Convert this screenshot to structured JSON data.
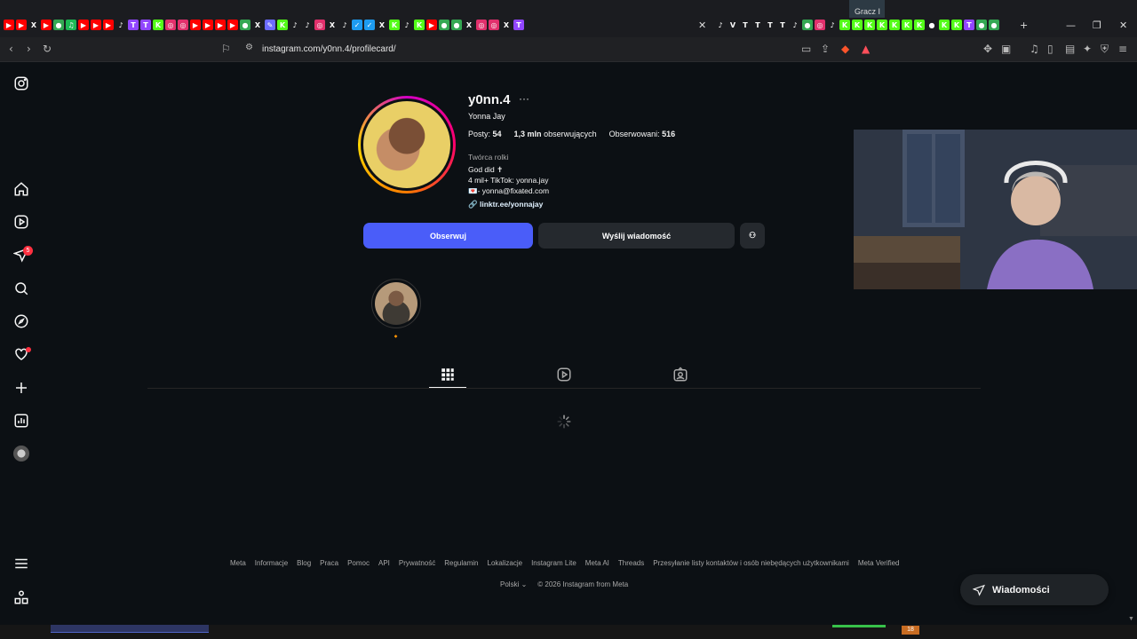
{
  "browser": {
    "url": "instagram.com/y0nn.4/profilecard/",
    "overlay_label": "Gracz I",
    "new_tab_symbol": "+",
    "tab_favicons": [
      {
        "name": "youtube-favicon",
        "color": "#ff0000",
        "glyph": "▶"
      },
      {
        "name": "youtube-favicon",
        "color": "#ff0000",
        "glyph": "▶"
      },
      {
        "name": "x-favicon",
        "color": "#1b1c20",
        "glyph": "X"
      },
      {
        "name": "youtube-favicon",
        "color": "#ff0000",
        "glyph": "▶"
      },
      {
        "name": "chrome-favicon",
        "color": "#34a853",
        "glyph": "●"
      },
      {
        "name": "green-favicon",
        "color": "#1db954",
        "glyph": "♫"
      },
      {
        "name": "youtube-favicon",
        "color": "#ff0000",
        "glyph": "▶"
      },
      {
        "name": "youtube-favicon",
        "color": "#ff0000",
        "glyph": "▶"
      },
      {
        "name": "youtube-favicon",
        "color": "#ff0000",
        "glyph": "▶"
      },
      {
        "name": "tiktok-favicon",
        "color": "#1b1c20",
        "glyph": "♪"
      },
      {
        "name": "twitch-favicon",
        "color": "#9146ff",
        "glyph": "T"
      },
      {
        "name": "twitch-favicon",
        "color": "#9146ff",
        "glyph": "T"
      },
      {
        "name": "kick-favicon",
        "color": "#53fc18",
        "glyph": "K"
      },
      {
        "name": "instagram-favicon",
        "color": "#e1306c",
        "glyph": "◎"
      },
      {
        "name": "instagram-favicon",
        "color": "#e1306c",
        "glyph": "◎"
      },
      {
        "name": "youtube-favicon",
        "color": "#ff0000",
        "glyph": "▶"
      },
      {
        "name": "youtube-favicon",
        "color": "#ff0000",
        "glyph": "▶"
      },
      {
        "name": "youtube-favicon",
        "color": "#ff0000",
        "glyph": "▶"
      },
      {
        "name": "youtube-favicon",
        "color": "#ff0000",
        "glyph": "▶"
      },
      {
        "name": "chrome-favicon",
        "color": "#34a853",
        "glyph": "●"
      },
      {
        "name": "x-favicon",
        "color": "#1b1c20",
        "glyph": "X"
      },
      {
        "name": "edit-favicon",
        "color": "#6c6cff",
        "glyph": "✎"
      },
      {
        "name": "kick-favicon",
        "color": "#53fc18",
        "glyph": "K"
      },
      {
        "name": "tiktok-favicon",
        "color": "#1b1c20",
        "glyph": "♪"
      },
      {
        "name": "tiktok-favicon",
        "color": "#1b1c20",
        "glyph": "♪"
      },
      {
        "name": "instagram-favicon",
        "color": "#e1306c",
        "glyph": "◎"
      },
      {
        "name": "x-favicon",
        "color": "#1b1c20",
        "glyph": "X"
      },
      {
        "name": "tiktok-favicon",
        "color": "#1b1c20",
        "glyph": "♪"
      },
      {
        "name": "check-favicon",
        "color": "#1d9bf0",
        "glyph": "✓"
      },
      {
        "name": "check-favicon",
        "color": "#1d9bf0",
        "glyph": "✓"
      },
      {
        "name": "x-favicon",
        "color": "#1b1c20",
        "glyph": "X"
      },
      {
        "name": "kick-favicon",
        "color": "#53fc18",
        "glyph": "K"
      },
      {
        "name": "tiktok-favicon",
        "color": "#1b1c20",
        "glyph": "♪"
      },
      {
        "name": "kick-favicon",
        "color": "#53fc18",
        "glyph": "K"
      },
      {
        "name": "youtube-favicon",
        "color": "#ff0000",
        "glyph": "▶"
      },
      {
        "name": "chrome-favicon",
        "color": "#34a853",
        "glyph": "●"
      },
      {
        "name": "chrome-favicon",
        "color": "#34a853",
        "glyph": "●"
      },
      {
        "name": "x-favicon",
        "color": "#1b1c20",
        "glyph": "X"
      },
      {
        "name": "instagram-favicon",
        "color": "#e1306c",
        "glyph": "◎"
      },
      {
        "name": "instagram-favicon",
        "color": "#e1306c",
        "glyph": "◎"
      },
      {
        "name": "x-favicon",
        "color": "#1b1c20",
        "glyph": "X"
      },
      {
        "name": "twitch-favicon",
        "color": "#9146ff",
        "glyph": "T"
      }
    ],
    "tab_favicons_right": [
      {
        "name": "tiktok-favicon",
        "color": "#1b1c20",
        "glyph": "♪"
      },
      {
        "name": "vivaldi-favicon",
        "color": "#1b1c20",
        "glyph": "V"
      },
      {
        "name": "tt-favicon",
        "color": "#1b1c20",
        "glyph": "T"
      },
      {
        "name": "tt-favicon",
        "color": "#1b1c20",
        "glyph": "T"
      },
      {
        "name": "tt-favicon",
        "color": "#1b1c20",
        "glyph": "T"
      },
      {
        "name": "tt-favicon",
        "color": "#1b1c20",
        "glyph": "T"
      },
      {
        "name": "tiktok-favicon",
        "color": "#1b1c20",
        "glyph": "♪"
      },
      {
        "name": "chrome-favicon",
        "color": "#34a853",
        "glyph": "●"
      },
      {
        "name": "instagram-favicon",
        "color": "#e1306c",
        "glyph": "◎"
      },
      {
        "name": "tiktok-favicon",
        "color": "#1b1c20",
        "glyph": "♪"
      },
      {
        "name": "kick-favicon",
        "color": "#53fc18",
        "glyph": "K"
      },
      {
        "name": "kick-favicon",
        "color": "#53fc18",
        "glyph": "K"
      },
      {
        "name": "kick-favicon",
        "color": "#53fc18",
        "glyph": "K"
      },
      {
        "name": "kick-favicon",
        "color": "#53fc18",
        "glyph": "K"
      },
      {
        "name": "kick-favicon",
        "color": "#53fc18",
        "glyph": "K"
      },
      {
        "name": "kick-favicon",
        "color": "#53fc18",
        "glyph": "K"
      },
      {
        "name": "kick-favicon",
        "color": "#53fc18",
        "glyph": "K"
      },
      {
        "name": "location-favicon",
        "color": "#1b1c20",
        "glyph": "●"
      },
      {
        "name": "kick-favicon",
        "color": "#53fc18",
        "glyph": "K"
      },
      {
        "name": "kick-favicon",
        "color": "#53fc18",
        "glyph": "K"
      },
      {
        "name": "twitch-favicon",
        "color": "#9146ff",
        "glyph": "T"
      },
      {
        "name": "chrome-favicon",
        "color": "#34a853",
        "glyph": "●"
      },
      {
        "name": "chrome-favicon",
        "color": "#34a853",
        "glyph": "●"
      }
    ]
  },
  "profile": {
    "username": "y0nn.4",
    "more_label": "···",
    "full_name": "Yonna Jay",
    "posts_label": "Posty:",
    "posts_value": "54",
    "followers_value": "1,3 mln",
    "followers_label": "obserwujących",
    "following_label": "Obserwowani:",
    "following_value": "516",
    "category": "Twórca rolki",
    "bio_lines": [
      "God did ✝",
      "4 mil+ TikTok: yonna.jay",
      "💌- yonna@fixated.com"
    ],
    "link": "linktr.ee/yonnajay",
    "follow_button": "Obserwuj",
    "message_button": "Wyślij wiadomość"
  },
  "highlight": {
    "label": "🔸"
  },
  "left_rail": {
    "notification_count": "5"
  },
  "footer": {
    "links": [
      "Meta",
      "Informacje",
      "Blog",
      "Praca",
      "Pomoc",
      "API",
      "Prywatność",
      "Regulamin",
      "Lokalizacje",
      "Instagram Lite",
      "Meta AI",
      "Threads",
      "Przesyłanie listy kontaktów i osób niebędących użytkownikami",
      "Meta Verified"
    ],
    "language": "Polski",
    "copyright": "© 2026 Instagram from Meta"
  },
  "messages_pill": {
    "label": "Wiadomości"
  },
  "taskbar": {
    "counter": "18"
  },
  "colors": {
    "accent": "#4a5df9",
    "background": "#0c1014",
    "badge": "#ff3040"
  }
}
